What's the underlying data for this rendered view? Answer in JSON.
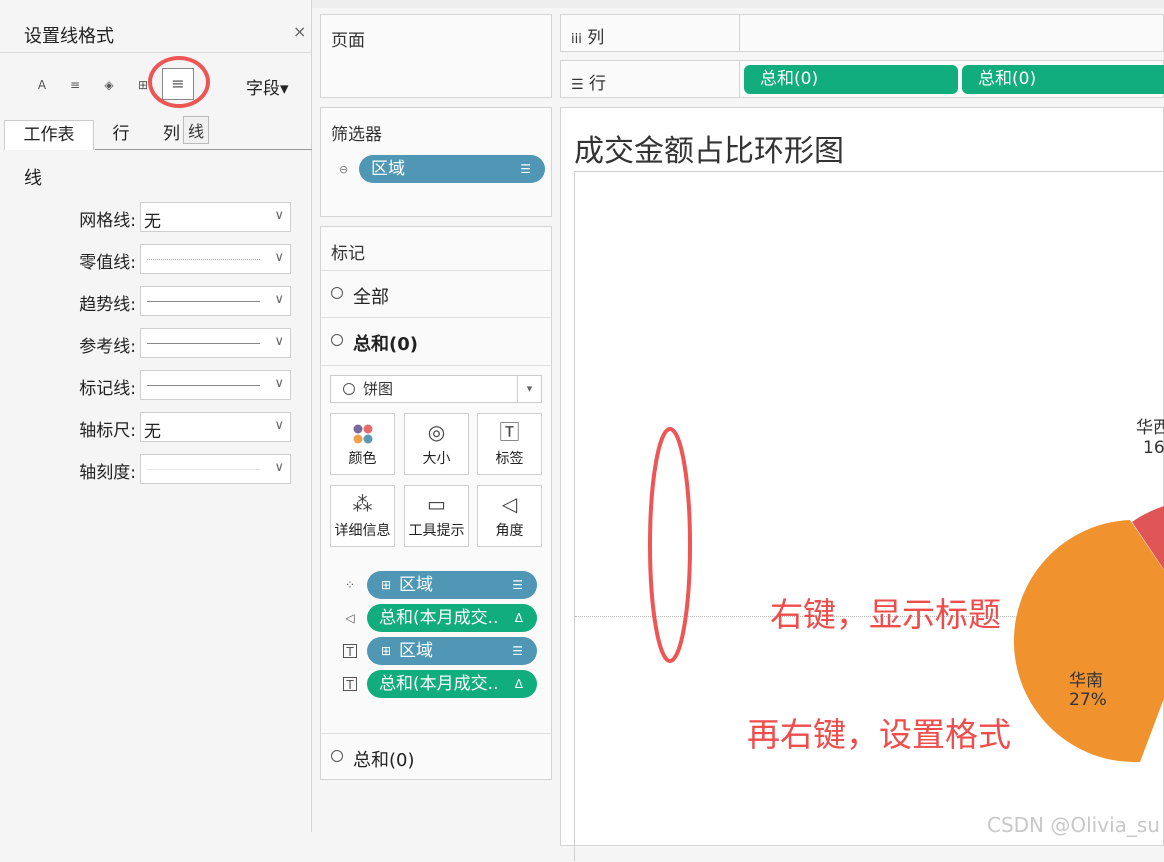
{
  "format_pane": {
    "title": "设置线格式",
    "close": "×",
    "field_menu": "字段▾",
    "tooltip": "线",
    "tabs": [
      "工作表",
      "行",
      "列"
    ],
    "section": "线",
    "rows": [
      {
        "label": "网格线:",
        "value": "无"
      },
      {
        "label": "零值线:",
        "value": ""
      },
      {
        "label": "趋势线:",
        "value": ""
      },
      {
        "label": "参考线:",
        "value": ""
      },
      {
        "label": "标记线:",
        "value": ""
      },
      {
        "label": "轴标尺:",
        "value": "无"
      },
      {
        "label": "轴刻度:",
        "value": ""
      }
    ]
  },
  "pages": {
    "title": "页面"
  },
  "filters": {
    "title": "筛选器",
    "pill": "区域"
  },
  "marks": {
    "title": "标记",
    "all": "全部",
    "sum1": "总和(0)",
    "mark_type": "饼图",
    "buttons": [
      "颜色",
      "大小",
      "标签",
      "详细信息",
      "工具提示",
      "角度"
    ],
    "fields": [
      "区域",
      "总和(本月成交..",
      "区域",
      "总和(本月成交.."
    ],
    "sum2": "总和(0)"
  },
  "shelves": {
    "columns_label": "列",
    "rows_label": "行",
    "row_pills": [
      "总和(0)",
      "总和(0)"
    ]
  },
  "viz": {
    "title": "成交金额占比环形图",
    "annotation1": "右键，显示标题",
    "annotation2": "再右键，设置格式",
    "label_west": "华西",
    "label_west_pct": "16",
    "label_south": "华南",
    "label_south_pct": "27%"
  },
  "watermark": "CSDN @Olivia_su",
  "colors": {
    "green": "#12ad7c",
    "blue": "#4f97b5",
    "red": "#ee5555",
    "orange": "#f0922e"
  }
}
